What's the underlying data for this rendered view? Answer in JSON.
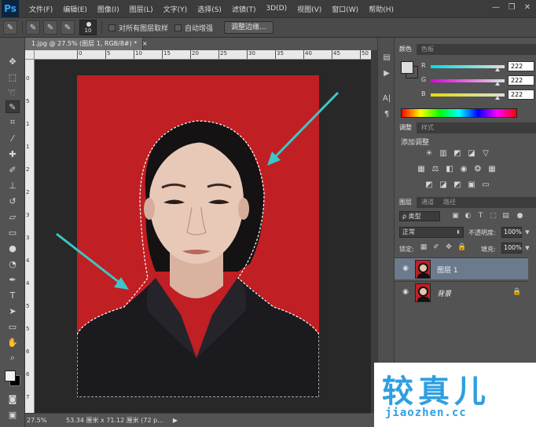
{
  "app": {
    "logo": "Ps"
  },
  "menu": [
    "文件(F)",
    "编辑(E)",
    "图像(I)",
    "图层(L)",
    "文字(Y)",
    "选择(S)",
    "滤镜(T)",
    "3D(D)",
    "视图(V)",
    "窗口(W)",
    "帮助(H)"
  ],
  "window_controls": {
    "minimize": "—",
    "restore": "❐",
    "close": "✕"
  },
  "options": {
    "brush_size": "10",
    "sample_all_layers_label": "对所有图层取样",
    "auto_enhance_label": "自动增强",
    "refine_edge_label": "调整边缘..."
  },
  "document": {
    "tab_title": "1.jpg @ 27.5% (图层 1, RGB/8#) *",
    "tab_close": "×",
    "ruler_h_labels": [
      "0",
      "5",
      "10",
      "15",
      "20",
      "25",
      "30",
      "35",
      "40",
      "45",
      "50",
      "55",
      "60"
    ],
    "ruler_v_labels": [
      "0",
      "5",
      "1",
      "1",
      "2",
      "2",
      "3",
      "3",
      "4",
      "4",
      "5",
      "5",
      "6",
      "6",
      "7"
    ]
  },
  "status": {
    "zoom": "27.5%",
    "doc_info": "53.34 厘米 x 71.12 厘米 (72 p...",
    "arrow": "▶"
  },
  "color_panel": {
    "tabs": [
      "颜色",
      "色板"
    ],
    "channels": [
      {
        "label": "R",
        "value": "222",
        "color": "#00c8c8"
      },
      {
        "label": "G",
        "value": "222",
        "color": "#c000c0"
      },
      {
        "label": "B",
        "value": "222",
        "color": "#c8c800"
      }
    ]
  },
  "adjustments_panel": {
    "tabs": [
      "调整",
      "样式"
    ],
    "title": "添加调整"
  },
  "layers_panel": {
    "tabs": [
      "图层",
      "通道",
      "路径"
    ],
    "filter": "ρ 类型",
    "blend_mode": "正常",
    "opacity_label": "不透明度:",
    "opacity_value": "100%",
    "lock_label": "锁定:",
    "fill_label": "填充:",
    "fill_value": "100%",
    "layers": [
      {
        "name": "图层 1",
        "selected": true
      },
      {
        "name": "背景",
        "selected": false,
        "locked": true
      }
    ]
  },
  "watermark": {
    "title": "较真儿",
    "url": "jiaozhen.cc"
  },
  "colors": {
    "photo_bg": "#c01f24",
    "arrow": "#3cc6c8",
    "accent": "#2f9fe0"
  }
}
